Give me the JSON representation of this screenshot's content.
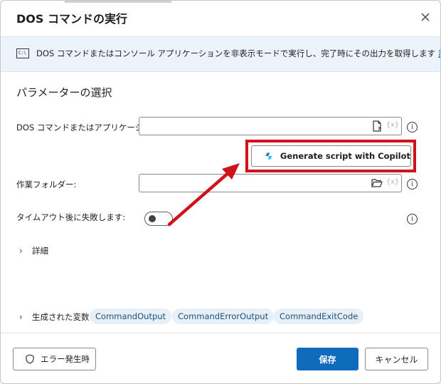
{
  "dialog": {
    "title": "DOS コマンドの実行",
    "close_icon": "close-icon"
  },
  "info": {
    "icon": "console-icon",
    "icon_text": "C:\\",
    "text": "DOS コマンドまたはコンソール アプリケーションを非表示モードで実行し、完了時にその出力を取得します",
    "link": "詳細"
  },
  "parameters": {
    "section_title": "パラメーターの選択",
    "command": {
      "label": "DOS コマンドまたはアプリケーション:",
      "value": "",
      "file_icon": "file-icon",
      "var_text": "{x}"
    },
    "copilot": {
      "label": "Generate script with Copilot",
      "icon": "copilot-icon"
    },
    "working_folder": {
      "label": "作業フォルダー:",
      "value": "",
      "folder_icon": "folder-icon",
      "var_text": "{x}"
    },
    "timeout": {
      "label": "タイムアウト後に失敗します:",
      "state": "off"
    },
    "details_label": "詳細"
  },
  "variables": {
    "label": "生成された変数",
    "items": [
      "CommandOutput",
      "CommandErrorOutput",
      "CommandExitCode"
    ]
  },
  "footer": {
    "error_label": "エラー発生時",
    "save_label": "保存",
    "cancel_label": "キャンセル"
  },
  "help_glyph": "i",
  "colors": {
    "accent": "#0f6cbd",
    "highlight": "#d0121b",
    "info_bg": "#edf3fa",
    "chip_bg": "#e8f0f7"
  }
}
